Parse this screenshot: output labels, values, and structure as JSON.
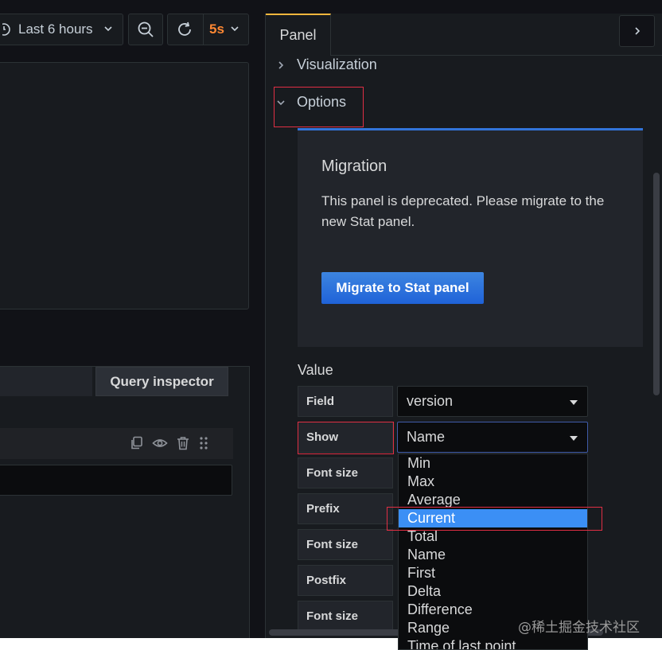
{
  "toolbar": {
    "time_range": "Last 6 hours",
    "refresh_rate": "5s"
  },
  "left": {
    "query_inspector_label": "Query inspector"
  },
  "options_pane": {
    "tab_label": "Panel",
    "sections": {
      "visualization": "Visualization",
      "options": "Options"
    },
    "migration": {
      "title": "Migration",
      "text": "This panel is deprecated. Please migrate to the new Stat panel.",
      "button_label": "Migrate to Stat panel"
    },
    "value": {
      "heading": "Value",
      "rows": [
        {
          "label": "Field",
          "value": "version"
        },
        {
          "label": "Show",
          "value": "Name"
        },
        {
          "label": "Font size"
        },
        {
          "label": "Prefix"
        },
        {
          "label": "Font size"
        },
        {
          "label": "Postfix"
        },
        {
          "label": "Font size"
        }
      ]
    },
    "show_dropdown": {
      "options": [
        "Min",
        "Max",
        "Average",
        "Current",
        "Total",
        "Name",
        "First",
        "Delta",
        "Difference",
        "Range",
        "Time of last point"
      ],
      "highlighted": "Current"
    }
  },
  "watermark": "@稀土掘金技术社区",
  "colors": {
    "accent_orange": "#ff8833",
    "primary_blue": "#1f62d8",
    "highlight_blue": "#3b8ff5",
    "annotation_red": "#e02f44",
    "panel_tab_border": "#f5b73d"
  }
}
